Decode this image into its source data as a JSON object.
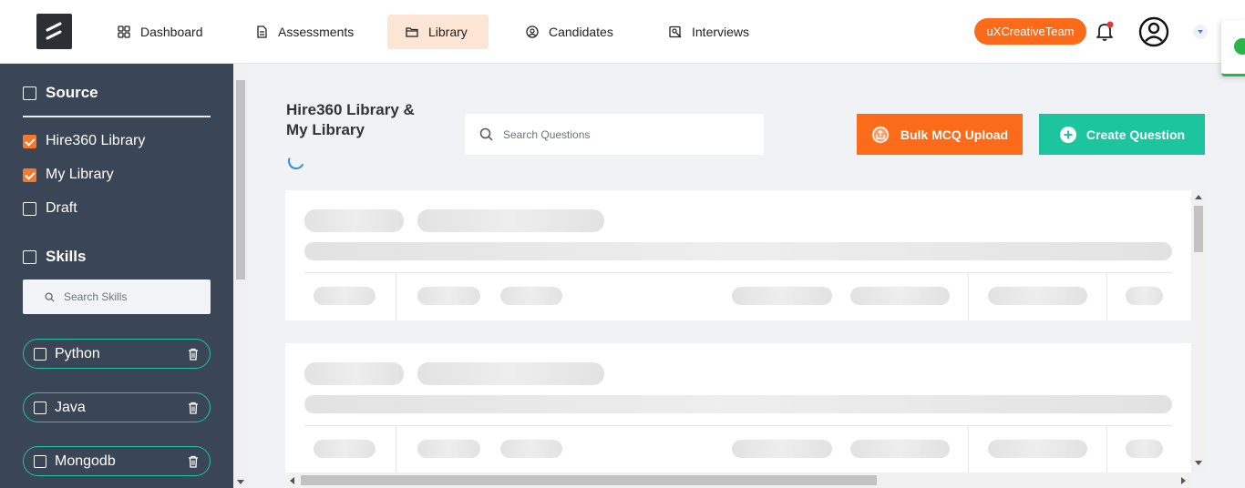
{
  "nav": {
    "items": [
      {
        "label": "Dashboard",
        "icon": "grid-icon"
      },
      {
        "label": "Assessments",
        "icon": "document-icon"
      },
      {
        "label": "Library",
        "icon": "folder-icon",
        "active": true
      },
      {
        "label": "Candidates",
        "icon": "user-circle-icon"
      },
      {
        "label": "Interviews",
        "icon": "interview-icon"
      }
    ],
    "team_label": "uXCreativeTeam"
  },
  "sidebar": {
    "source_heading": "Source",
    "sources": [
      {
        "label": "Hire360 Library",
        "checked": true
      },
      {
        "label": "My Library",
        "checked": true
      },
      {
        "label": "Draft",
        "checked": false
      }
    ],
    "skills_heading": "Skills",
    "skills_search_placeholder": "Search Skills",
    "skills": [
      {
        "label": "Python",
        "checked": false
      },
      {
        "label": "Java",
        "checked": false
      },
      {
        "label": "Mongodb",
        "checked": false
      }
    ]
  },
  "main": {
    "title_line1": "Hire360 Library &",
    "title_line2": "My Library",
    "search_placeholder": "Search Questions",
    "bulk_upload_label": "Bulk MCQ Upload",
    "create_question_label": "Create Question"
  },
  "colors": {
    "accent_orange": "#fb6b1a",
    "accent_green": "#1cc59e",
    "sidebar_bg": "#3a4556",
    "active_nav_bg": "#fde5d6"
  }
}
